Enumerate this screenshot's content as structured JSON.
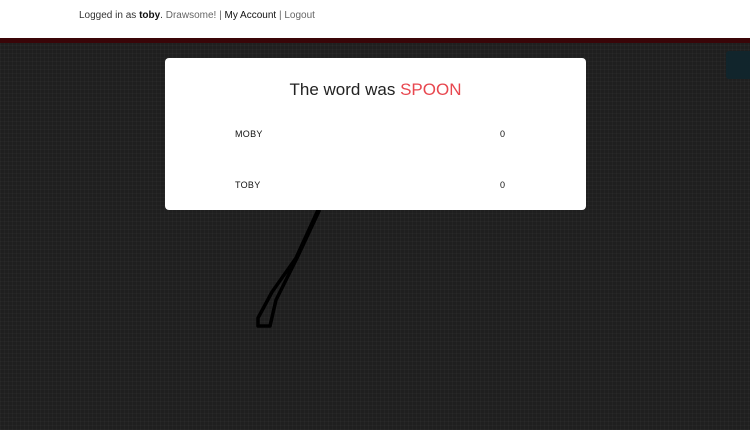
{
  "header": {
    "logged_in_prefix": "Logged in as",
    "username": "toby",
    "app_name": "Drawsome!",
    "sep1": "|",
    "my_account": "My Account",
    "sep2": "|",
    "logout": "Logout"
  },
  "modal": {
    "title_prefix": "The word was",
    "word": "SPOON",
    "scores": [
      {
        "name": "MOBY",
        "score": "0"
      },
      {
        "name": "TOBY",
        "score": "0"
      }
    ]
  },
  "colors": {
    "accent_word": "#e8474f",
    "header_strip": "#3a0508",
    "canvas_bg": "#1f1f1f"
  }
}
